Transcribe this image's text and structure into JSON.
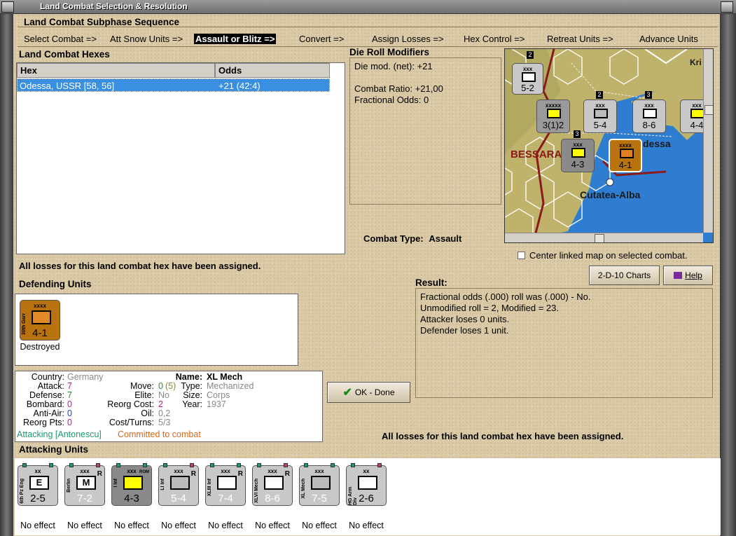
{
  "window": {
    "title": "Land Combat Selection & Resolution"
  },
  "subphase": {
    "title": "Land Combat Subphase Sequence",
    "steps": [
      "Select Combat =>",
      "Att Snow Units =>",
      "Assault or Blitz =>",
      "Convert =>",
      "Assign Losses =>",
      "Hex Control =>",
      "Retreat Units =>",
      "Advance Units"
    ],
    "active_index": 2
  },
  "hexes": {
    "title": "Land Combat Hexes",
    "columns": [
      "Hex",
      "Odds"
    ],
    "rows": [
      {
        "hex": "Odessa, USSR [58, 56]",
        "odds": "+21 (42:4)"
      }
    ]
  },
  "modifiers": {
    "title": "Die Roll Modifiers",
    "lines": [
      "Die mod. (net): +21",
      "",
      "Combat Ratio: +21,00",
      "Fractional Odds: 0"
    ]
  },
  "combat_type": {
    "label": "Combat Type:",
    "value": "Assault"
  },
  "center_map": {
    "label": "Center linked map on selected combat.",
    "checked": false
  },
  "losses_msg": "All losses for this land combat hex have been assigned.",
  "buttons": {
    "charts": "2-D-10 Charts",
    "help": "Help",
    "ok": "OK - Done"
  },
  "result": {
    "title": "Result:",
    "lines": [
      "Fractional odds (.000) roll was (.000)  - No.",
      "Unmodified roll = 2, Modified = 23.",
      "Attacker loses 0 units.",
      "Defender loses 1 unit."
    ]
  },
  "defending": {
    "title": "Defending Units",
    "units": [
      {
        "size": "xxxx",
        "name": "30th Garr",
        "value": "4-1",
        "status": "Destroyed",
        "color": "#b8730f"
      }
    ]
  },
  "info": {
    "country_label": "Country:",
    "country": "Germany",
    "attack_label": "Attack:",
    "attack": "7",
    "defense_label": "Defense:",
    "defense": "7",
    "bombard_label": "Bombard:",
    "bombard": "0",
    "antiair_label": "Anti-Air:",
    "antiair": "0",
    "reorg_label": "Reorg Pts:",
    "reorg": "0",
    "move_label": "Move:",
    "move": "0",
    "move_extra": "(5)",
    "elite_label": "Elite:",
    "elite": "No",
    "reorgcost_label": "Reorg Cost:",
    "reorgcost": "2",
    "oil_label": "Oil:",
    "oil": "0,2",
    "costturns_label": "Cost/Turns:",
    "costturns": "5/3",
    "name_label": "Name:",
    "name": "XL Mech",
    "type_label": "Type:",
    "type": "Mechanized",
    "size_label": "Size:",
    "size": "Corps",
    "year_label": "Year:",
    "year": "1937",
    "attacking": "Attacking [Antonescu]",
    "committed": "Committed to combat"
  },
  "attacking": {
    "title": "Attacking Units",
    "units": [
      {
        "size": "xx",
        "name": "6th Pz Eng",
        "value": "2-5",
        "status": "No effect",
        "sym": "E"
      },
      {
        "size": "xxx",
        "name": "Berlin",
        "value": "7-2",
        "status": "No effect",
        "sym": "M",
        "tag": "R"
      },
      {
        "size": "xxx",
        "name": "I Inf",
        "value": "4-3",
        "status": "No effect",
        "sym": "",
        "tag": "ROM"
      },
      {
        "size": "xxx",
        "name": "LI Inf",
        "value": "5-4",
        "status": "No effect",
        "sym": "",
        "tag": "R"
      },
      {
        "size": "xxx",
        "name": "XLIII Inf",
        "value": "7-4",
        "status": "No effect",
        "sym": "",
        "tag": "R"
      },
      {
        "size": "xxx",
        "name": "XLVI Mech",
        "value": "8-6",
        "status": "No effect",
        "sym": "",
        "tag": "R"
      },
      {
        "size": "xxx",
        "name": "XL Mech",
        "value": "7-5",
        "status": "No effect",
        "sym": ""
      },
      {
        "size": "xx",
        "name": "HG Arm Div",
        "value": "2-6",
        "status": "No effect",
        "sym": ""
      }
    ]
  },
  "map": {
    "labels": [
      "BESSARA",
      "dessa",
      "Cutatea-Alba",
      "Kri"
    ],
    "counters": [
      {
        "value": "5-2",
        "size": "xxx",
        "sym": "M"
      },
      {
        "value": "3(1)2",
        "size": "xxxxx",
        "tag": "ROM"
      },
      {
        "value": "5-4",
        "size": "xxx",
        "tag": "R"
      },
      {
        "value": "8-6",
        "size": "xxx",
        "tag": "R"
      },
      {
        "value": "4-4",
        "size": "xxx"
      },
      {
        "value": "4-3",
        "size": "xxx"
      },
      {
        "value": "4-1",
        "size": "xxxx"
      }
    ],
    "badges": [
      "2",
      "2",
      "3",
      "3"
    ]
  },
  "colors": {
    "panel": "#d9c9a6",
    "selected": "#3b8fe0",
    "german": "#c8c8c8",
    "romanian": "#8a8a8a",
    "garrison": "#b8730f",
    "attacking": "#1a9b6a",
    "committed": "#d2691e"
  }
}
